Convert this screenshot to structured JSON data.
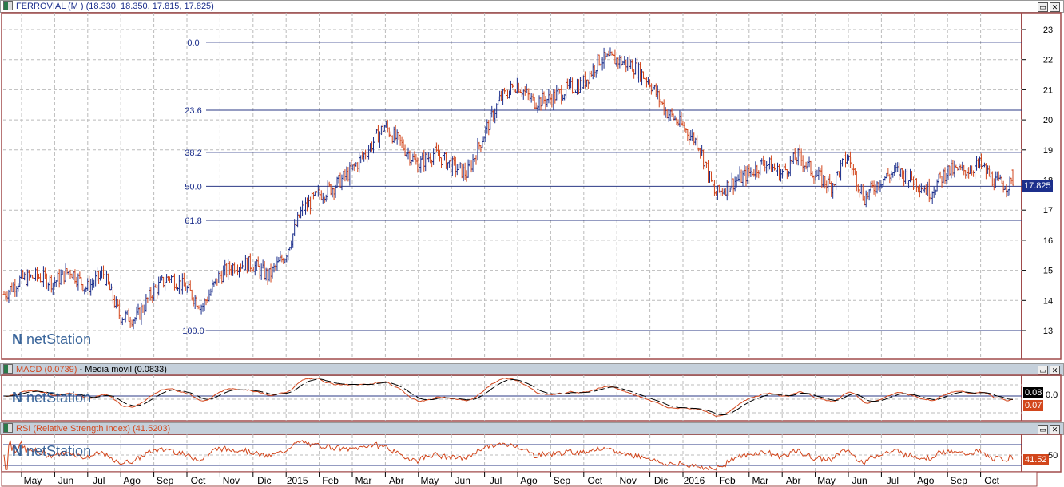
{
  "main": {
    "title": "FERROVIAL (M ) (18.330, 18.350, 17.815, 17.825)",
    "last_price": "17.825",
    "watermark": "netStation"
  },
  "macd": {
    "title": "MACD (0.0739)",
    "title2": "Media móvil (0.0833)",
    "value_macd": "0.08",
    "value_signal": "0.07",
    "zero_label": "0.0"
  },
  "rsi": {
    "title": "RSI (Relative Strength Index) (41.5203)",
    "value": "41.52",
    "mid_label": "50"
  },
  "colors": {
    "up": "#1c2f8c",
    "down": "#d2461c",
    "fib": "#2b3a86",
    "frame": "#a04a4a",
    "header": "#c5d0db",
    "macd": "#d2461c",
    "signal": "#000000"
  },
  "chart_data": {
    "type": "ohlc",
    "title": "FERROVIAL (M )",
    "y_ticks": [
      "23",
      "22",
      "21",
      "20",
      "19",
      "18",
      "17",
      "16",
      "15",
      "14",
      "13"
    ],
    "ylim": [
      12.5,
      23.5
    ],
    "x_labels": [
      "May",
      "Jun",
      "Jul",
      "Ago",
      "Sep",
      "Oct",
      "Nov",
      "Dic",
      "2015",
      "Feb",
      "Mar",
      "Abr",
      "May",
      "Jun",
      "Jul",
      "Ago",
      "Sep",
      "Oct",
      "Nov",
      "Dic",
      "2016",
      "Feb",
      "Mar",
      "Abr",
      "May",
      "Jun",
      "Jul",
      "Ago",
      "Sep",
      "Oct"
    ],
    "fibonacci": [
      {
        "label": "0.0",
        "price": 22.58
      },
      {
        "label": "23.6",
        "price": 20.32
      },
      {
        "label": "38.2",
        "price": 18.92
      },
      {
        "label": "50.0",
        "price": 17.79
      },
      {
        "label": "61.8",
        "price": 16.66
      },
      {
        "label": "100.0",
        "price": 13.0
      }
    ],
    "approx_closes_semimonthly": [
      14.2,
      14.7,
      14.8,
      14.6,
      15.0,
      14.4,
      14.9,
      13.5,
      13.4,
      14.3,
      14.8,
      14.4,
      13.8,
      14.8,
      15.2,
      15.2,
      14.8,
      15.5,
      17.0,
      17.5,
      17.8,
      18.3,
      19.0,
      19.8,
      19.2,
      18.5,
      18.9,
      18.5,
      18.2,
      19.5,
      20.7,
      21.2,
      20.6,
      20.7,
      21.0,
      21.2,
      22.0,
      22.0,
      21.8,
      21.3,
      20.3,
      19.8,
      19.2,
      17.5,
      17.9,
      18.2,
      18.6,
      18.2,
      18.8,
      18.2,
      17.8,
      18.8,
      17.4,
      18.0,
      18.3,
      18.0,
      17.6,
      18.3,
      18.3,
      18.5,
      17.9,
      17.825
    ],
    "last": {
      "open": 18.33,
      "high": 18.35,
      "low": 17.815,
      "close": 17.825
    },
    "macd": {
      "value": 0.0739,
      "signal": 0.0833
    },
    "rsi": {
      "value": 41.5203,
      "levels": [
        30,
        50,
        70
      ]
    }
  }
}
